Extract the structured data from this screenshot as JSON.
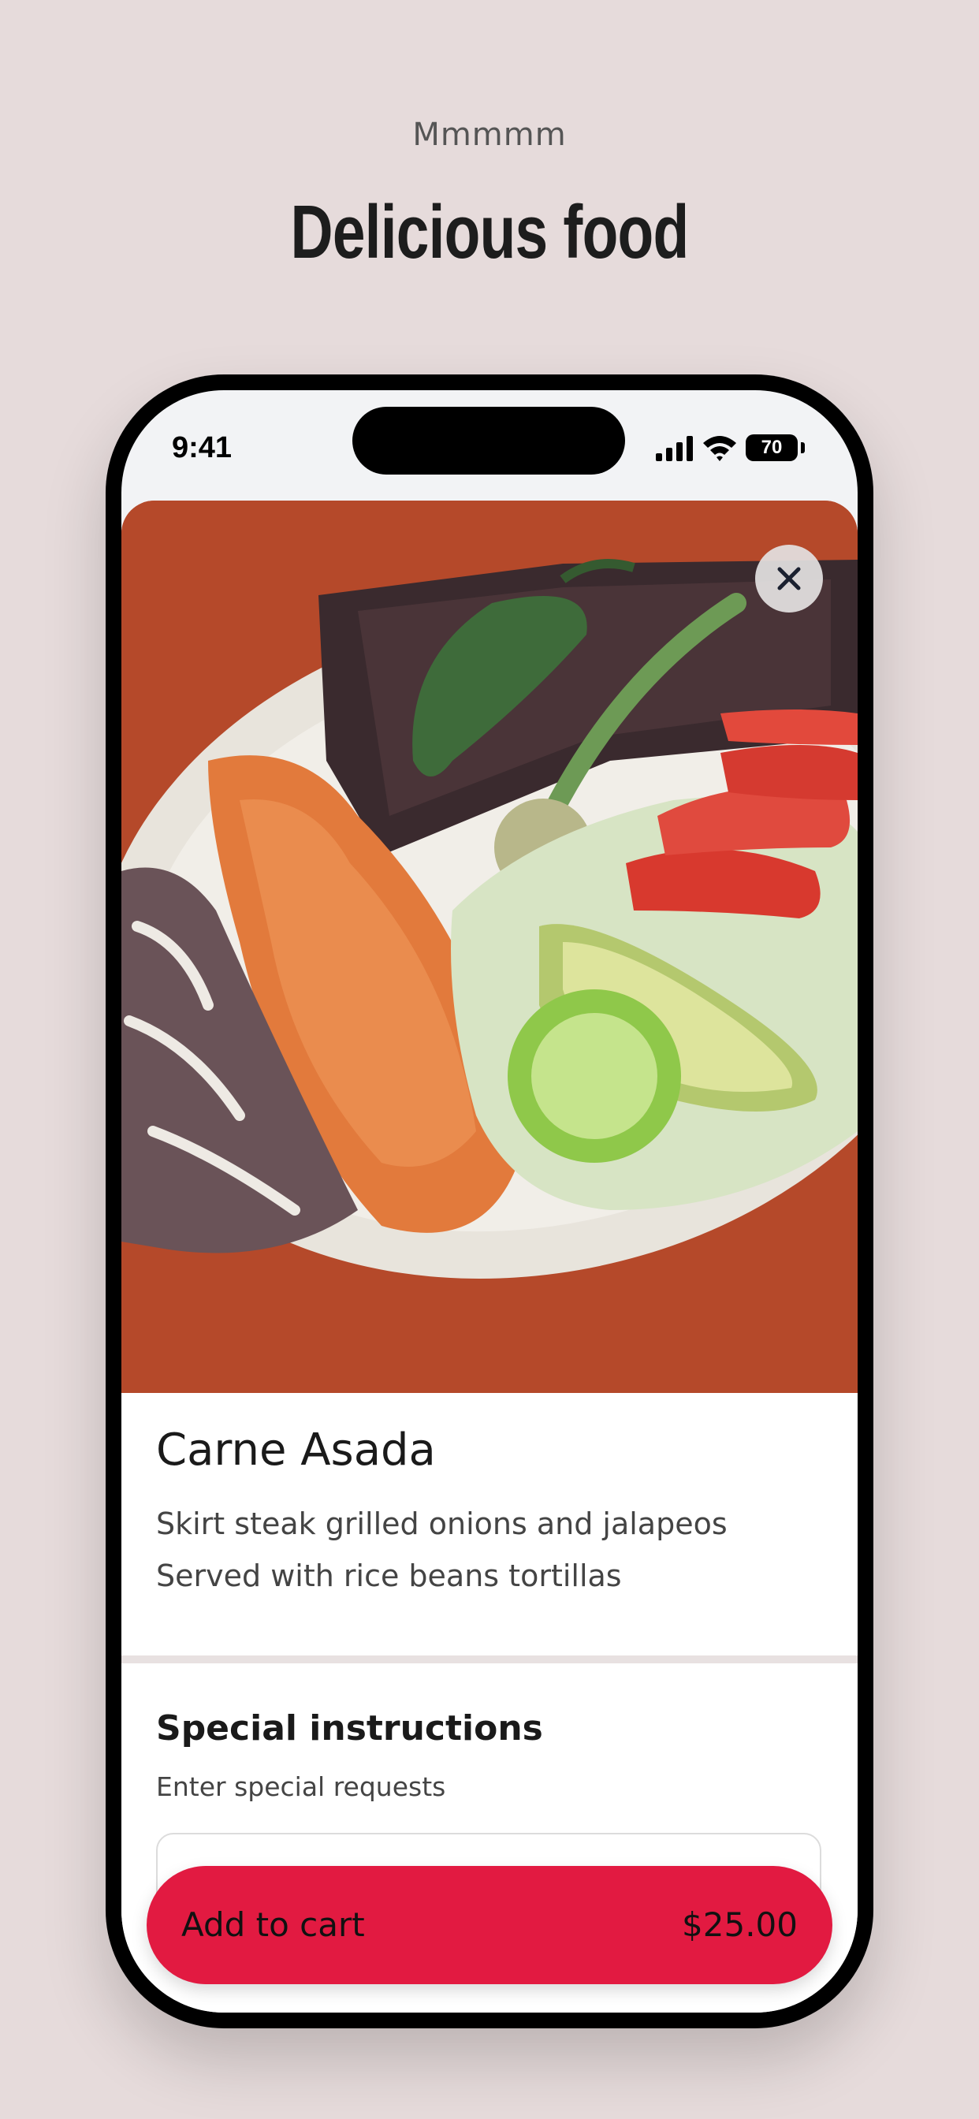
{
  "header": {
    "eyebrow": "Mmmmm",
    "title": "Delicious food"
  },
  "status_bar": {
    "time": "9:41",
    "battery": "70",
    "icons": [
      "signal-icon",
      "wifi-icon",
      "battery-icon"
    ]
  },
  "item": {
    "image": "food-photo",
    "name": "Carne Asada",
    "description_lines": [
      "Skirt steak grilled onions and jalapeos",
      "Served with rice beans tortillas"
    ]
  },
  "special_instructions": {
    "title": "Special instructions",
    "hint": "Enter special requests",
    "value": ""
  },
  "cart": {
    "label": "Add to cart",
    "price": "$25.00"
  },
  "colors": {
    "page_background": "#e6dbdb",
    "accent": "#e21a41",
    "text": "#1a1a1a"
  }
}
